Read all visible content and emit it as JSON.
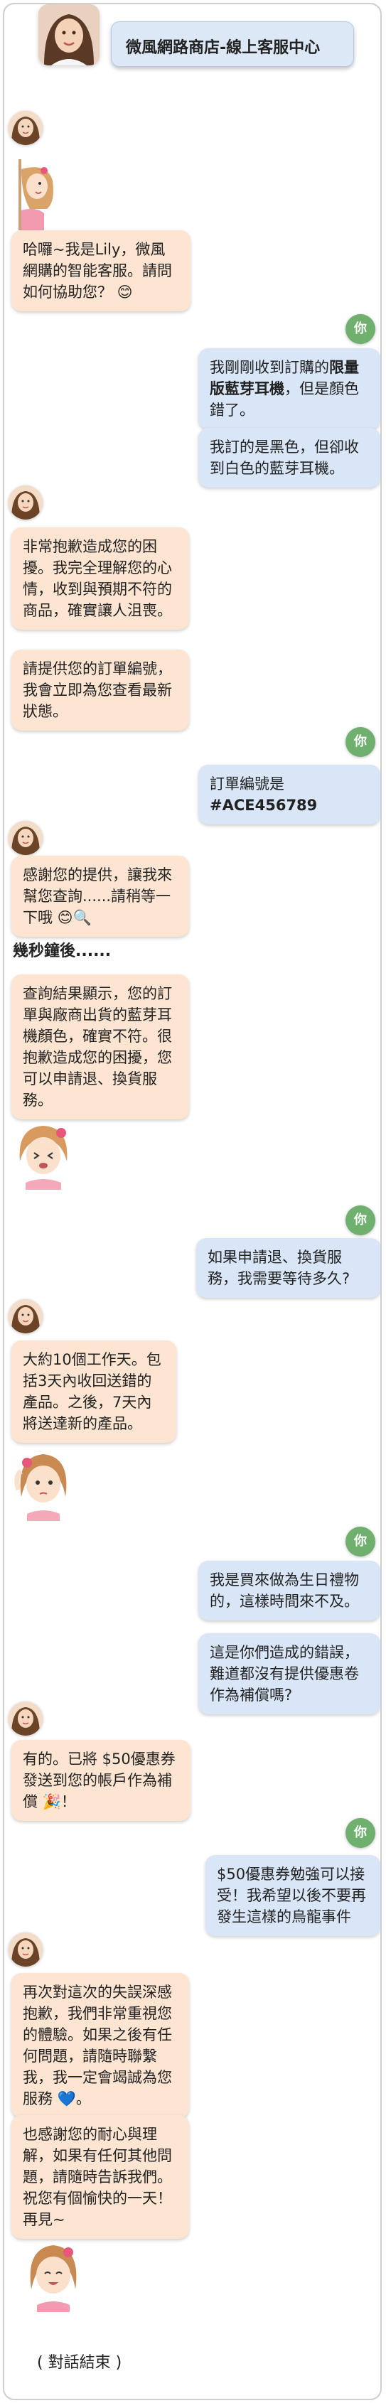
{
  "header": {
    "title": "微風網路商店-線上客服中心"
  },
  "user_avatar": {
    "label": "你"
  },
  "messages": {
    "bot1": "哈囉~我是Lily，微風網購的智能客服。請問如何協助您？",
    "user1a_pre": "我剛剛收到訂購的",
    "user1a_bold": "限量版藍芽耳機",
    "user1a_post": "，但是顏色錯了。",
    "user1b": "我訂的是黑色，但卻收到白色的藍芽耳機。",
    "bot2a": "非常抱歉造成您的困擾。我完全理解您的心情，收到與預期不符的商品，確實讓人沮喪。",
    "bot2b": "請提供您的訂單編號，我會立即為您查看最新狀態。",
    "user2_pre": "訂單編號是",
    "user2_bold": "#ACE456789",
    "bot3": "感謝您的提供，讓我來幫您查詢......請稍等一下哦",
    "wait_note": "幾秒鐘後......",
    "bot4": "查詢結果顯示，您的訂單與廠商出貨的藍芽耳機顏色，確實不符。很抱歉造成您的困擾，您可以申請退、換貨服務。",
    "user3": "如果申請退、換貨服務，我需要等待多久?",
    "bot5": "大約10個工作天。包括3天內收回送錯的產品。之後，7天內將送達新的產品。",
    "user4a": "我是買來做為生日禮物的，這樣時間來不及。",
    "user4b": "這是你們造成的錯誤，難道都沒有提供優惠卷作為補償嗎?",
    "bot6": "有的。已將 $50優惠券發送到您的帳戶作為補償",
    "user5": "$50優惠券勉強可以接受！我希望以後不要再發生這樣的烏龍事件",
    "bot7": "再次對這次的失誤深感抱歉，我們非常重視您的體驗。如果之後有任何問題，請隨時聯繫我，我一定會竭誠為您服務",
    "bot8": "也感謝您的耐心與理解，如果有任何其他問題，請隨時告訴我們。祝您有個愉快的一天！再見~",
    "end": "( 對話結束 )"
  },
  "colors": {
    "bot_bubble": "#fde5d2",
    "user_bubble": "#d9e6f7",
    "user_avatar": "#6fb06f"
  }
}
